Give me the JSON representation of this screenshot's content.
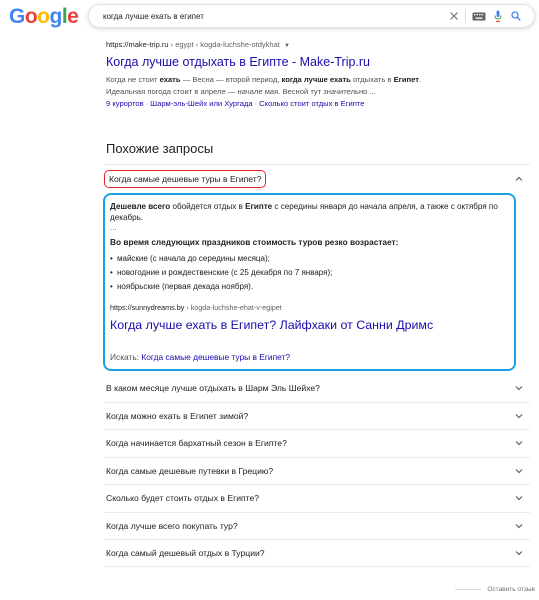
{
  "logo": {
    "letters": [
      "G",
      "o",
      "o",
      "g",
      "l",
      "e"
    ],
    "colors": [
      "#4285f4",
      "#ea4335",
      "#fbbc05",
      "#4285f4",
      "#34a853",
      "#ea4335"
    ]
  },
  "search": {
    "query": "когда лучше ехать в египет"
  },
  "result": {
    "site": "https://make-trip.ru",
    "path": "› egypt › kogda-luchshe-otdykhat",
    "title": "Когда лучше отдыхать в Египте - Make-Trip.ru",
    "snippet_1": "Когда не стоит ",
    "snippet_b1": "ехать",
    "snippet_2": " — Весна — второй период, ",
    "snippet_b2": "когда лучше ехать",
    "snippet_3": " отдыхать в ",
    "snippet_b3": "Египет",
    "snippet_4": ".",
    "snippet_line2": "Идеальная погода стоит в апреле — начале мая. Весной тут значительно ...",
    "sitelinks": [
      "9 курортов",
      "Шарм-эль-Шейх или Хургада",
      "Сколько стоит отдых в Египте"
    ]
  },
  "related": {
    "heading": "Похожие запросы",
    "open_question": "Когда самые дешевые туры в Египет?",
    "answer": {
      "p_b1": "Дешевле всего",
      "p_1": " обойдется отдых в ",
      "p_b2": "Египте",
      "p_2": " с середины января до начала апреля, а также с октября по декабрь.",
      "ellipsis": "...",
      "heading": "Во время следующих праздников стоимость туров резко возрастает:",
      "items": [
        "майские (с начала до середины месяца);",
        "новогодние и рождественские (с 25 декабря по 7 января);",
        "ноябрьские (первая декада ноября)."
      ],
      "site": "https://sunnydreams.by",
      "path": "› kogda-luchshe-ehat-v-egipet",
      "title": "Когда лучше ехать в Египет? Лайфхаки от Санни Дримс",
      "search_prefix": "Искать: ",
      "search_link": "Когда самые дешевые туры в Египет?"
    },
    "questions": [
      "В каком месяце лучше отдыхать в Шарм Эль Шейхе?",
      "Когда можно ехать в Египет зимой?",
      "Когда начинается бархатный сезон в Египте?",
      "Когда самые дешевые путевки в Грецию?",
      "Сколько будет стоить отдых в Египте?",
      "Когда лучше всего покупать тур?",
      "Когда самый дешевый отдых в Турции?"
    ]
  },
  "feedback": "Оставить отзыв"
}
